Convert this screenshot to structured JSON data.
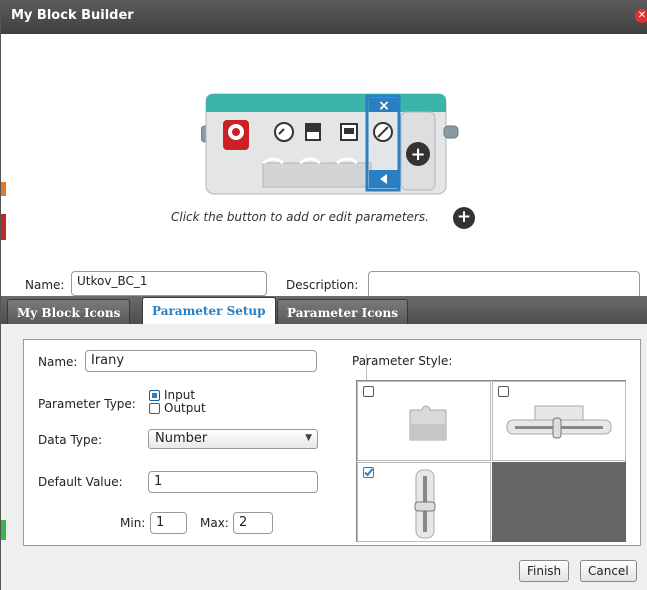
{
  "window": {
    "title": "My Block Builder",
    "close_glyph": "✕"
  },
  "block_preview": {
    "selected_close_glyph": "×",
    "add_glyph": "+"
  },
  "hint": {
    "text": "Click the button to add or edit parameters.",
    "plus_glyph": "+"
  },
  "header_form": {
    "name_label": "Name:",
    "name_value": "Utkov_BC_1",
    "description_label": "Description:",
    "description_value": ""
  },
  "tabs": [
    {
      "label": "My Block Icons",
      "active": false
    },
    {
      "label": "Parameter Setup",
      "active": true
    },
    {
      "label": "Parameter Icons",
      "active": false
    }
  ],
  "param": {
    "name_label": "Name:",
    "name_value": "Irany",
    "type_label": "Parameter Type:",
    "type_options": [
      {
        "label": "Input",
        "checked": true
      },
      {
        "label": "Output",
        "checked": false
      }
    ],
    "data_type_label": "Data Type:",
    "data_type_value": "Number",
    "default_label": "Default Value:",
    "default_value": "1",
    "min_label": "Min:",
    "min_value": "1",
    "max_label": "Max:",
    "max_value": "2",
    "style_label": "Parameter Style:",
    "styles": [
      {
        "name": "block-style",
        "checked": false
      },
      {
        "name": "horizontal-slider-style",
        "checked": false
      },
      {
        "name": "vertical-slider-style",
        "checked": true
      }
    ]
  },
  "buttons": {
    "finish": "Finish",
    "cancel": "Cancel"
  },
  "colors": {
    "accent": "#2a7fc2",
    "teal": "#3bb5a9",
    "brain_red": "#cc2027"
  }
}
